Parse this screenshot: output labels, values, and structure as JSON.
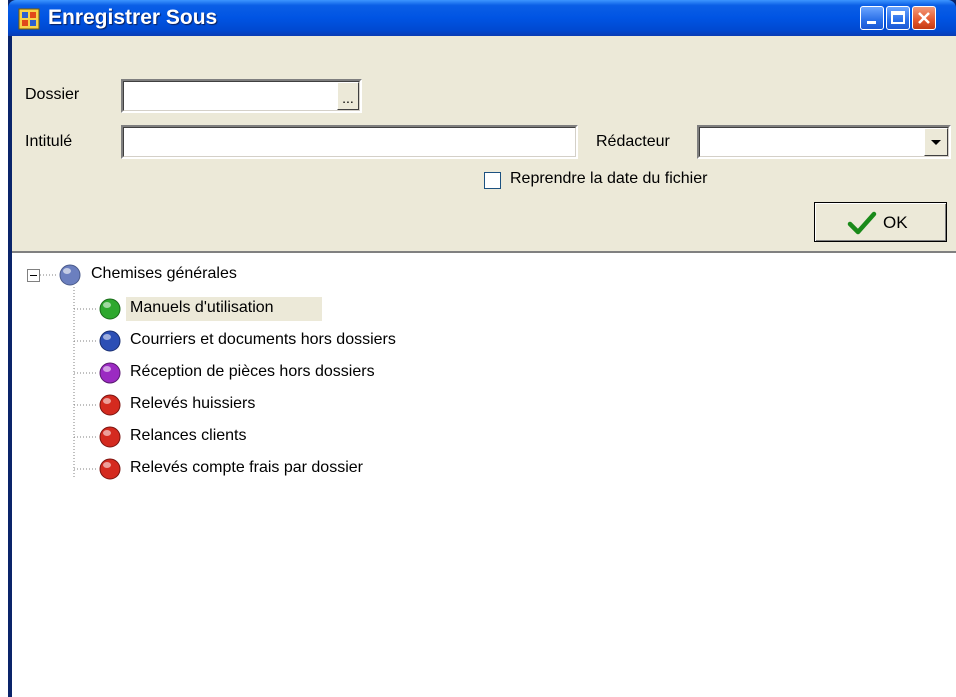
{
  "window": {
    "title": "Enregistrer Sous"
  },
  "form": {
    "dossier_label": "Dossier",
    "dossier_value": "",
    "browse_label": "...",
    "intitule_label": "Intitulé",
    "intitule_value": "",
    "redacteur_label": "Rédacteur",
    "redacteur_value": "",
    "checkbox_label": "Reprendre la date du fichier",
    "checkbox_checked": false,
    "ok_label": "OK"
  },
  "tree": {
    "root": {
      "label": "Chemises générales",
      "color": "#6b7fbf",
      "expanded": true
    },
    "items": [
      {
        "label": "Manuels d'utilisation",
        "color": "#2ea82e",
        "selected": true
      },
      {
        "label": "Courriers et documents hors dossiers",
        "color": "#2c4fb5"
      },
      {
        "label": "Réception de pièces hors dossiers",
        "color": "#9b2ac2"
      },
      {
        "label": "Relevés huissiers",
        "color": "#d42a1f"
      },
      {
        "label": "Relances clients",
        "color": "#d42a1f"
      },
      {
        "label": "Relevés compte frais par dossier",
        "color": "#d42a1f"
      }
    ]
  }
}
